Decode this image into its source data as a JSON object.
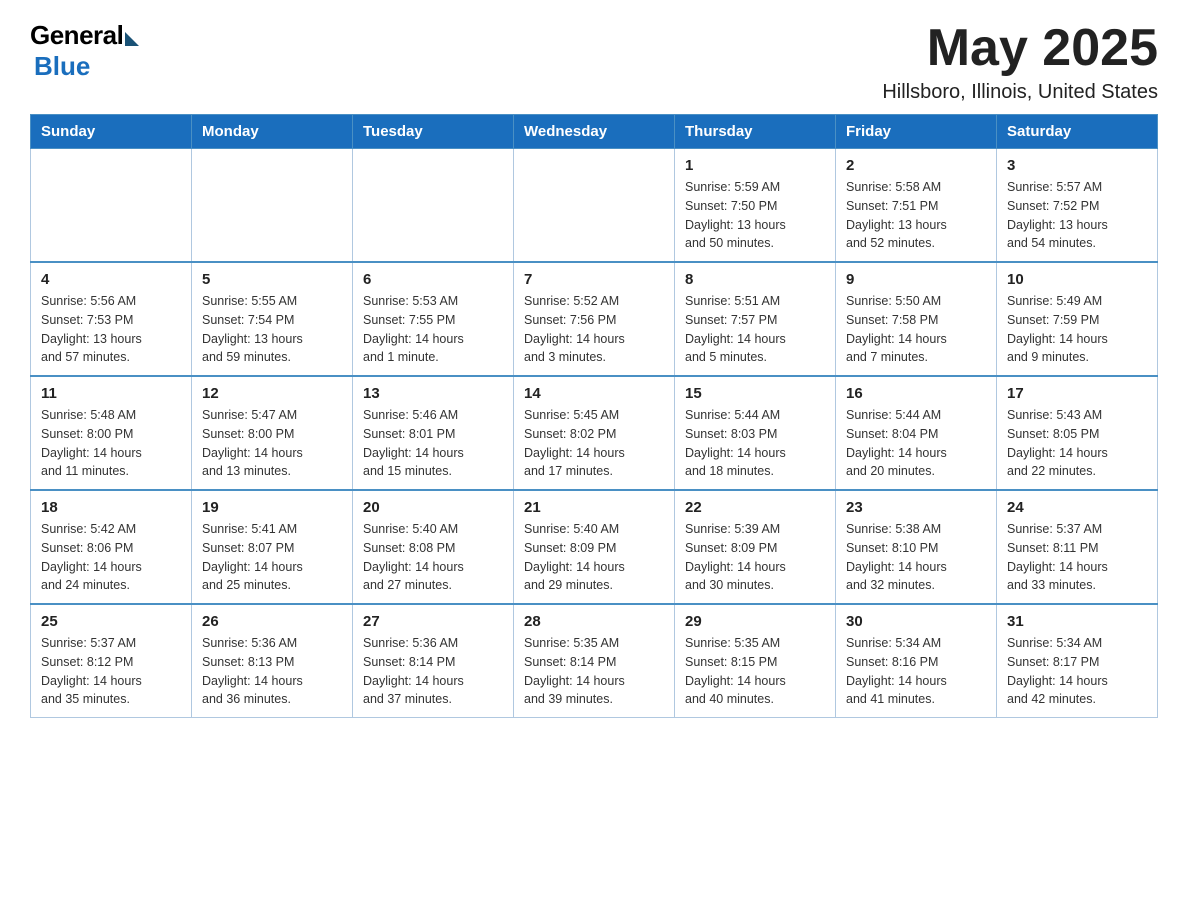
{
  "header": {
    "logo": {
      "general": "General",
      "blue": "Blue"
    },
    "title": "May 2025",
    "location": "Hillsboro, Illinois, United States"
  },
  "weekdays": [
    "Sunday",
    "Monday",
    "Tuesday",
    "Wednesday",
    "Thursday",
    "Friday",
    "Saturday"
  ],
  "weeks": [
    [
      {
        "day": "",
        "info": ""
      },
      {
        "day": "",
        "info": ""
      },
      {
        "day": "",
        "info": ""
      },
      {
        "day": "",
        "info": ""
      },
      {
        "day": "1",
        "info": "Sunrise: 5:59 AM\nSunset: 7:50 PM\nDaylight: 13 hours\nand 50 minutes."
      },
      {
        "day": "2",
        "info": "Sunrise: 5:58 AM\nSunset: 7:51 PM\nDaylight: 13 hours\nand 52 minutes."
      },
      {
        "day": "3",
        "info": "Sunrise: 5:57 AM\nSunset: 7:52 PM\nDaylight: 13 hours\nand 54 minutes."
      }
    ],
    [
      {
        "day": "4",
        "info": "Sunrise: 5:56 AM\nSunset: 7:53 PM\nDaylight: 13 hours\nand 57 minutes."
      },
      {
        "day": "5",
        "info": "Sunrise: 5:55 AM\nSunset: 7:54 PM\nDaylight: 13 hours\nand 59 minutes."
      },
      {
        "day": "6",
        "info": "Sunrise: 5:53 AM\nSunset: 7:55 PM\nDaylight: 14 hours\nand 1 minute."
      },
      {
        "day": "7",
        "info": "Sunrise: 5:52 AM\nSunset: 7:56 PM\nDaylight: 14 hours\nand 3 minutes."
      },
      {
        "day": "8",
        "info": "Sunrise: 5:51 AM\nSunset: 7:57 PM\nDaylight: 14 hours\nand 5 minutes."
      },
      {
        "day": "9",
        "info": "Sunrise: 5:50 AM\nSunset: 7:58 PM\nDaylight: 14 hours\nand 7 minutes."
      },
      {
        "day": "10",
        "info": "Sunrise: 5:49 AM\nSunset: 7:59 PM\nDaylight: 14 hours\nand 9 minutes."
      }
    ],
    [
      {
        "day": "11",
        "info": "Sunrise: 5:48 AM\nSunset: 8:00 PM\nDaylight: 14 hours\nand 11 minutes."
      },
      {
        "day": "12",
        "info": "Sunrise: 5:47 AM\nSunset: 8:00 PM\nDaylight: 14 hours\nand 13 minutes."
      },
      {
        "day": "13",
        "info": "Sunrise: 5:46 AM\nSunset: 8:01 PM\nDaylight: 14 hours\nand 15 minutes."
      },
      {
        "day": "14",
        "info": "Sunrise: 5:45 AM\nSunset: 8:02 PM\nDaylight: 14 hours\nand 17 minutes."
      },
      {
        "day": "15",
        "info": "Sunrise: 5:44 AM\nSunset: 8:03 PM\nDaylight: 14 hours\nand 18 minutes."
      },
      {
        "day": "16",
        "info": "Sunrise: 5:44 AM\nSunset: 8:04 PM\nDaylight: 14 hours\nand 20 minutes."
      },
      {
        "day": "17",
        "info": "Sunrise: 5:43 AM\nSunset: 8:05 PM\nDaylight: 14 hours\nand 22 minutes."
      }
    ],
    [
      {
        "day": "18",
        "info": "Sunrise: 5:42 AM\nSunset: 8:06 PM\nDaylight: 14 hours\nand 24 minutes."
      },
      {
        "day": "19",
        "info": "Sunrise: 5:41 AM\nSunset: 8:07 PM\nDaylight: 14 hours\nand 25 minutes."
      },
      {
        "day": "20",
        "info": "Sunrise: 5:40 AM\nSunset: 8:08 PM\nDaylight: 14 hours\nand 27 minutes."
      },
      {
        "day": "21",
        "info": "Sunrise: 5:40 AM\nSunset: 8:09 PM\nDaylight: 14 hours\nand 29 minutes."
      },
      {
        "day": "22",
        "info": "Sunrise: 5:39 AM\nSunset: 8:09 PM\nDaylight: 14 hours\nand 30 minutes."
      },
      {
        "day": "23",
        "info": "Sunrise: 5:38 AM\nSunset: 8:10 PM\nDaylight: 14 hours\nand 32 minutes."
      },
      {
        "day": "24",
        "info": "Sunrise: 5:37 AM\nSunset: 8:11 PM\nDaylight: 14 hours\nand 33 minutes."
      }
    ],
    [
      {
        "day": "25",
        "info": "Sunrise: 5:37 AM\nSunset: 8:12 PM\nDaylight: 14 hours\nand 35 minutes."
      },
      {
        "day": "26",
        "info": "Sunrise: 5:36 AM\nSunset: 8:13 PM\nDaylight: 14 hours\nand 36 minutes."
      },
      {
        "day": "27",
        "info": "Sunrise: 5:36 AM\nSunset: 8:14 PM\nDaylight: 14 hours\nand 37 minutes."
      },
      {
        "day": "28",
        "info": "Sunrise: 5:35 AM\nSunset: 8:14 PM\nDaylight: 14 hours\nand 39 minutes."
      },
      {
        "day": "29",
        "info": "Sunrise: 5:35 AM\nSunset: 8:15 PM\nDaylight: 14 hours\nand 40 minutes."
      },
      {
        "day": "30",
        "info": "Sunrise: 5:34 AM\nSunset: 8:16 PM\nDaylight: 14 hours\nand 41 minutes."
      },
      {
        "day": "31",
        "info": "Sunrise: 5:34 AM\nSunset: 8:17 PM\nDaylight: 14 hours\nand 42 minutes."
      }
    ]
  ]
}
